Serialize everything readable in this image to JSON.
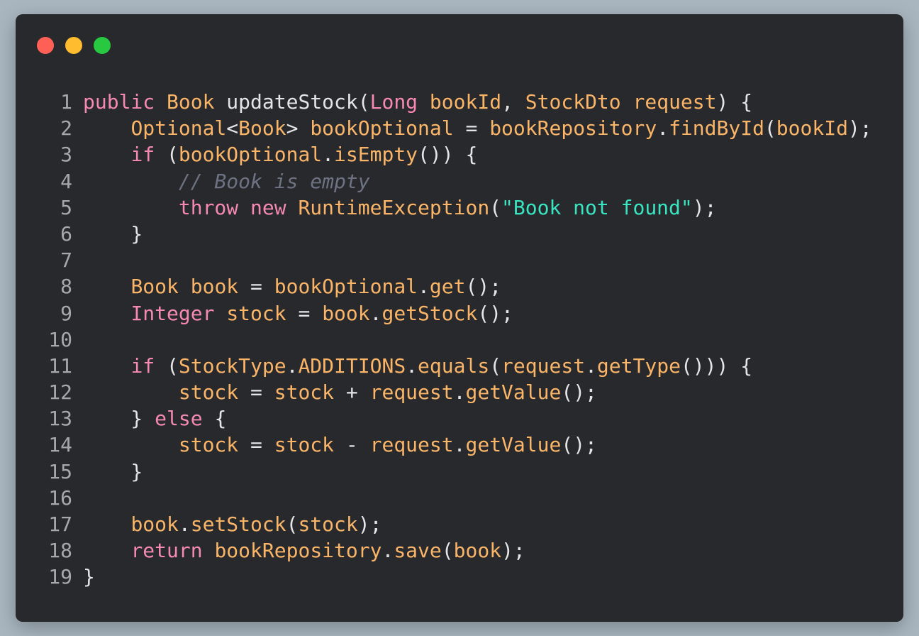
{
  "window": {
    "controls": [
      {
        "name": "close",
        "color": "#fe5f57"
      },
      {
        "name": "minimize",
        "color": "#febc2e"
      },
      {
        "name": "maximize",
        "color": "#28c840"
      }
    ]
  },
  "theme": {
    "background": "#28292c",
    "keyword": "#f589b2",
    "identifier": "#fab568",
    "punctuation": "#e5e5e7",
    "string": "#39e4c1",
    "comment": "#6d7383",
    "line_number": "#a8a8ab"
  },
  "code": {
    "lines": [
      {
        "n": "1",
        "tokens": [
          {
            "t": "public",
            "c": "pl"
          },
          {
            "t": " ",
            "c": "wh"
          },
          {
            "t": "Book",
            "c": "or"
          },
          {
            "t": " updateStock",
            "c": "wh"
          },
          {
            "t": "(",
            "c": "wh"
          },
          {
            "t": "Long",
            "c": "pl"
          },
          {
            "t": " ",
            "c": "wh"
          },
          {
            "t": "bookId",
            "c": "or"
          },
          {
            "t": ", ",
            "c": "wh"
          },
          {
            "t": "StockDto",
            "c": "or"
          },
          {
            "t": " ",
            "c": "wh"
          },
          {
            "t": "request",
            "c": "or"
          },
          {
            "t": ") {",
            "c": "wh"
          }
        ]
      },
      {
        "n": "2",
        "tokens": [
          {
            "t": "    ",
            "c": "wh"
          },
          {
            "t": "Optional",
            "c": "or"
          },
          {
            "t": "<",
            "c": "wh"
          },
          {
            "t": "Book",
            "c": "or"
          },
          {
            "t": "> ",
            "c": "wh"
          },
          {
            "t": "bookOptional",
            "c": "or"
          },
          {
            "t": " = ",
            "c": "wh"
          },
          {
            "t": "bookRepository",
            "c": "or"
          },
          {
            "t": ".",
            "c": "wh"
          },
          {
            "t": "findById",
            "c": "or"
          },
          {
            "t": "(",
            "c": "wh"
          },
          {
            "t": "bookId",
            "c": "or"
          },
          {
            "t": ");",
            "c": "wh"
          }
        ]
      },
      {
        "n": "3",
        "tokens": [
          {
            "t": "    ",
            "c": "wh"
          },
          {
            "t": "if",
            "c": "pl"
          },
          {
            "t": " (",
            "c": "wh"
          },
          {
            "t": "bookOptional",
            "c": "or"
          },
          {
            "t": ".",
            "c": "wh"
          },
          {
            "t": "isEmpty",
            "c": "or"
          },
          {
            "t": "()) {",
            "c": "wh"
          }
        ]
      },
      {
        "n": "4",
        "tokens": [
          {
            "t": "        ",
            "c": "wh"
          },
          {
            "t": "// Book is empty",
            "c": "cm"
          }
        ]
      },
      {
        "n": "5",
        "tokens": [
          {
            "t": "        ",
            "c": "wh"
          },
          {
            "t": "throw",
            "c": "pl"
          },
          {
            "t": " ",
            "c": "wh"
          },
          {
            "t": "new",
            "c": "pl"
          },
          {
            "t": " ",
            "c": "wh"
          },
          {
            "t": "RuntimeException",
            "c": "or"
          },
          {
            "t": "(",
            "c": "wh"
          },
          {
            "t": "\"Book not found\"",
            "c": "st"
          },
          {
            "t": ");",
            "c": "wh"
          }
        ]
      },
      {
        "n": "6",
        "tokens": [
          {
            "t": "    }",
            "c": "wh"
          }
        ]
      },
      {
        "n": "7",
        "tokens": []
      },
      {
        "n": "8",
        "tokens": [
          {
            "t": "    ",
            "c": "wh"
          },
          {
            "t": "Book",
            "c": "or"
          },
          {
            "t": " ",
            "c": "wh"
          },
          {
            "t": "book",
            "c": "or"
          },
          {
            "t": " = ",
            "c": "wh"
          },
          {
            "t": "bookOptional",
            "c": "or"
          },
          {
            "t": ".",
            "c": "wh"
          },
          {
            "t": "get",
            "c": "or"
          },
          {
            "t": "();",
            "c": "wh"
          }
        ]
      },
      {
        "n": "9",
        "tokens": [
          {
            "t": "    ",
            "c": "wh"
          },
          {
            "t": "Integer",
            "c": "pl"
          },
          {
            "t": " ",
            "c": "wh"
          },
          {
            "t": "stock",
            "c": "or"
          },
          {
            "t": " = ",
            "c": "wh"
          },
          {
            "t": "book",
            "c": "or"
          },
          {
            "t": ".",
            "c": "wh"
          },
          {
            "t": "getStock",
            "c": "or"
          },
          {
            "t": "();",
            "c": "wh"
          }
        ]
      },
      {
        "n": "10",
        "tokens": []
      },
      {
        "n": "11",
        "tokens": [
          {
            "t": "    ",
            "c": "wh"
          },
          {
            "t": "if",
            "c": "pl"
          },
          {
            "t": " (",
            "c": "wh"
          },
          {
            "t": "StockType",
            "c": "or"
          },
          {
            "t": ".",
            "c": "wh"
          },
          {
            "t": "ADDITIONS",
            "c": "or"
          },
          {
            "t": ".",
            "c": "wh"
          },
          {
            "t": "equals",
            "c": "or"
          },
          {
            "t": "(",
            "c": "wh"
          },
          {
            "t": "request",
            "c": "or"
          },
          {
            "t": ".",
            "c": "wh"
          },
          {
            "t": "getType",
            "c": "or"
          },
          {
            "t": "())) {",
            "c": "wh"
          }
        ]
      },
      {
        "n": "12",
        "tokens": [
          {
            "t": "        ",
            "c": "wh"
          },
          {
            "t": "stock",
            "c": "or"
          },
          {
            "t": " = ",
            "c": "wh"
          },
          {
            "t": "stock",
            "c": "or"
          },
          {
            "t": " + ",
            "c": "wh"
          },
          {
            "t": "request",
            "c": "or"
          },
          {
            "t": ".",
            "c": "wh"
          },
          {
            "t": "getValue",
            "c": "or"
          },
          {
            "t": "();",
            "c": "wh"
          }
        ]
      },
      {
        "n": "13",
        "tokens": [
          {
            "t": "    } ",
            "c": "wh"
          },
          {
            "t": "else",
            "c": "pl"
          },
          {
            "t": " {",
            "c": "wh"
          }
        ]
      },
      {
        "n": "14",
        "tokens": [
          {
            "t": "        ",
            "c": "wh"
          },
          {
            "t": "stock",
            "c": "or"
          },
          {
            "t": " = ",
            "c": "wh"
          },
          {
            "t": "stock",
            "c": "or"
          },
          {
            "t": " - ",
            "c": "wh"
          },
          {
            "t": "request",
            "c": "or"
          },
          {
            "t": ".",
            "c": "wh"
          },
          {
            "t": "getValue",
            "c": "or"
          },
          {
            "t": "();",
            "c": "wh"
          }
        ]
      },
      {
        "n": "15",
        "tokens": [
          {
            "t": "    }",
            "c": "wh"
          }
        ]
      },
      {
        "n": "16",
        "tokens": []
      },
      {
        "n": "17",
        "tokens": [
          {
            "t": "    ",
            "c": "wh"
          },
          {
            "t": "book",
            "c": "or"
          },
          {
            "t": ".",
            "c": "wh"
          },
          {
            "t": "setStock",
            "c": "or"
          },
          {
            "t": "(",
            "c": "wh"
          },
          {
            "t": "stock",
            "c": "or"
          },
          {
            "t": ");",
            "c": "wh"
          }
        ]
      },
      {
        "n": "18",
        "tokens": [
          {
            "t": "    ",
            "c": "wh"
          },
          {
            "t": "return",
            "c": "pl"
          },
          {
            "t": " ",
            "c": "wh"
          },
          {
            "t": "bookRepository",
            "c": "or"
          },
          {
            "t": ".",
            "c": "wh"
          },
          {
            "t": "save",
            "c": "or"
          },
          {
            "t": "(",
            "c": "wh"
          },
          {
            "t": "book",
            "c": "or"
          },
          {
            "t": ");",
            "c": "wh"
          }
        ]
      },
      {
        "n": "19",
        "tokens": [
          {
            "t": "}",
            "c": "wh"
          }
        ]
      }
    ]
  }
}
